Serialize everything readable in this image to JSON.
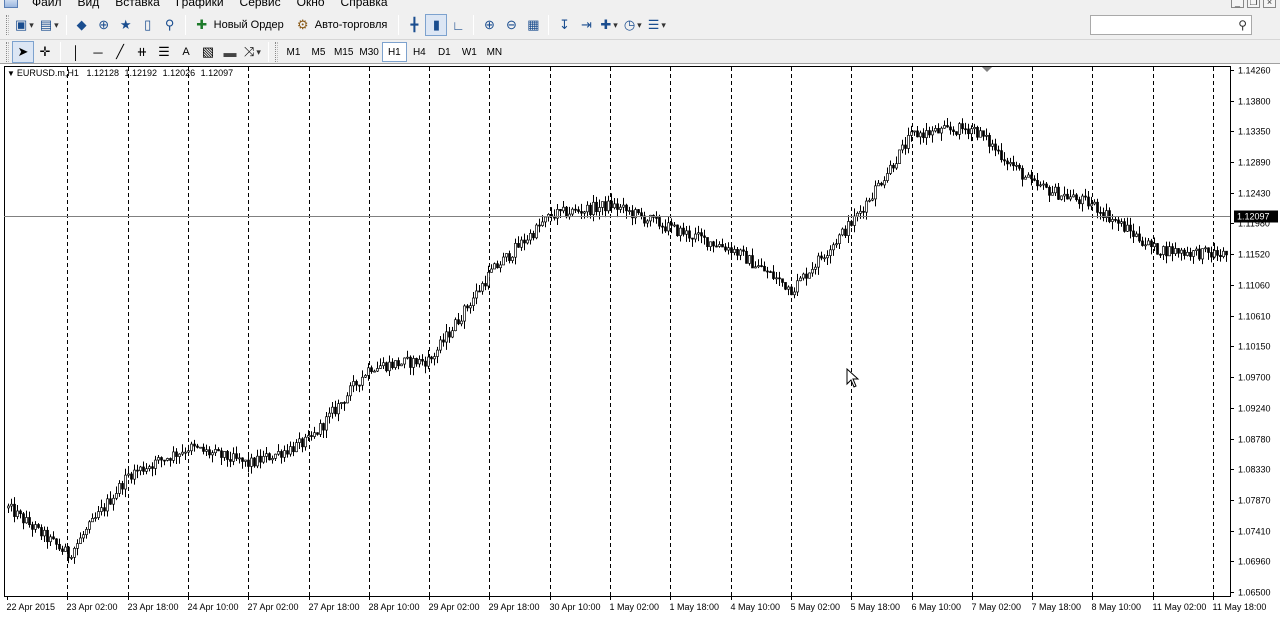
{
  "menubar": {
    "items": [
      "Файл",
      "Вид",
      "Вставка",
      "Графики",
      "Сервис",
      "Окно",
      "Справка"
    ]
  },
  "toolbar": {
    "new_order_label": "Новый Ордер",
    "auto_trading_label": "Авто-торговля",
    "search": {
      "value": "",
      "placeholder": ""
    }
  },
  "timeframes": [
    "M1",
    "M5",
    "M15",
    "M30",
    "H1",
    "H4",
    "D1",
    "W1",
    "MN"
  ],
  "active_timeframe": "H1",
  "chart": {
    "symbol": "EURUSD.m,H1",
    "open": "1.12128",
    "high": "1.12192",
    "low": "1.12026",
    "close": "1.12097",
    "current_price_label": "1.12097"
  },
  "chart_data": {
    "type": "candlestick",
    "symbol": "EURUSD.m",
    "timeframe": "H1",
    "y_ticks": [
      "1.14260",
      "1.13800",
      "1.13350",
      "1.12890",
      "1.12430",
      "1.11980",
      "1.11520",
      "1.11060",
      "1.10610",
      "1.10150",
      "1.09700",
      "1.09240",
      "1.08780",
      "1.08330",
      "1.07870",
      "1.07410",
      "1.06960",
      "1.06500"
    ],
    "ylim": [
      1.065,
      1.1426
    ],
    "x_ticks": [
      "22 Apr 2015",
      "23 Apr 02:00",
      "23 Apr 18:00",
      "24 Apr 10:00",
      "27 Apr 02:00",
      "27 Apr 18:00",
      "28 Apr 10:00",
      "29 Apr 02:00",
      "29 Apr 18:00",
      "30 Apr 10:00",
      "1 May 02:00",
      "1 May 18:00",
      "4 May 10:00",
      "5 May 02:00",
      "5 May 18:00",
      "6 May 10:00",
      "7 May 02:00",
      "7 May 18:00",
      "8 May 10:00",
      "11 May 02:00",
      "11 May 18:00"
    ],
    "price_path": [
      [
        "22 Apr 2015",
        1.0775
      ],
      [
        "23 Apr 02:00",
        1.0705
      ],
      [
        "23 Apr 18:00",
        1.0825
      ],
      [
        "24 Apr 10:00",
        1.0865
      ],
      [
        "27 Apr 02:00",
        1.084
      ],
      [
        "27 Apr 18:00",
        1.0875
      ],
      [
        "28 Apr 10:00",
        1.0985
      ],
      [
        "29 Apr 02:00",
        1.0995
      ],
      [
        "29 Apr 18:00",
        1.1125
      ],
      [
        "30 Apr 10:00",
        1.121
      ],
      [
        "1 May 02:00",
        1.1225
      ],
      [
        "1 May 18:00",
        1.119
      ],
      [
        "4 May 10:00",
        1.116
      ],
      [
        "5 May 02:00",
        1.11
      ],
      [
        "5 May 18:00",
        1.12
      ],
      [
        "6 May 10:00",
        1.133
      ],
      [
        "7 May 02:00",
        1.134
      ],
      [
        "7 May 18:00",
        1.1255
      ],
      [
        "8 May 10:00",
        1.1225
      ],
      [
        "11 May 02:00",
        1.116
      ],
      [
        "11 May 18:00",
        1.1152
      ]
    ],
    "current_price": 1.12097,
    "grid": "vertical dashed period separators",
    "colors": {
      "candles": "#000000",
      "background": "#ffffff",
      "price_line": "#808080",
      "price_tag_bg": "#000000"
    }
  }
}
